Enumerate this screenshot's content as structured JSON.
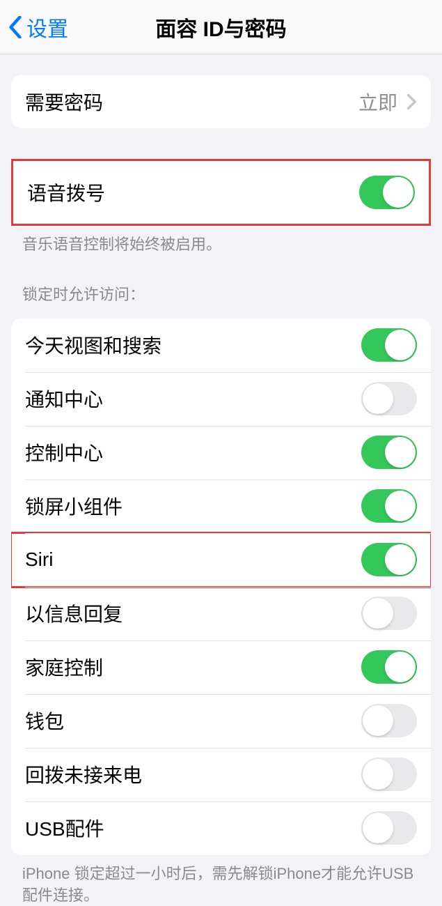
{
  "nav": {
    "back_label": "设置",
    "title": "面容 ID与密码"
  },
  "require_passcode": {
    "label": "需要密码",
    "value": "立即"
  },
  "voice_dial": {
    "label": "语音拨号",
    "note": "音乐语音控制将始终被启用。"
  },
  "lock_section": {
    "header": "锁定时允许访问：",
    "items": [
      {
        "label": "今天视图和搜索",
        "on": true
      },
      {
        "label": "通知中心",
        "on": false
      },
      {
        "label": "控制中心",
        "on": true
      },
      {
        "label": "锁屏小组件",
        "on": true
      },
      {
        "label": "Siri",
        "on": true
      },
      {
        "label": "以信息回复",
        "on": false
      },
      {
        "label": "家庭控制",
        "on": true
      },
      {
        "label": "钱包",
        "on": false
      },
      {
        "label": "回拨未接来电",
        "on": false
      },
      {
        "label": "USB配件",
        "on": false
      }
    ],
    "footer": "iPhone 锁定超过一小时后，需先解锁iPhone才能允许USB 配件连接。"
  }
}
